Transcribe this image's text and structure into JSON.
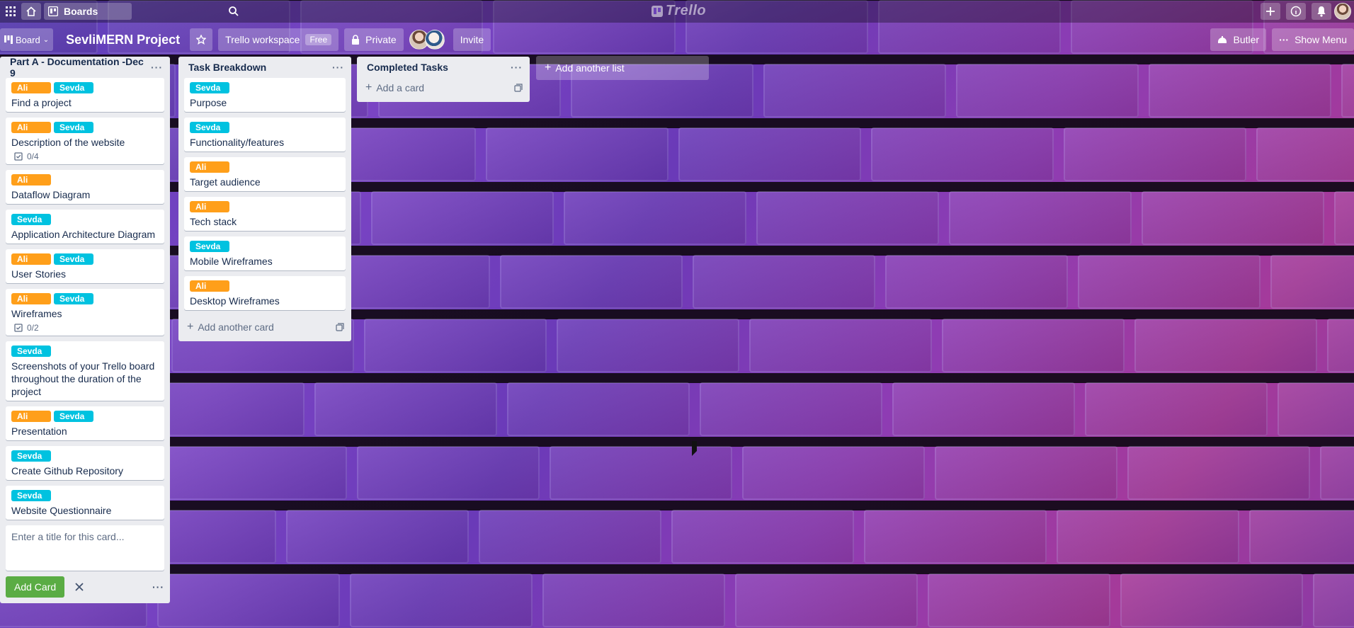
{
  "app": {
    "logo": "Trello",
    "boards_label": "Boards"
  },
  "board": {
    "view_label": "Board",
    "title": "SevliMERN Project",
    "workspace_label": "Trello workspace",
    "workspace_badge": "Free",
    "visibility_label": "Private",
    "invite_label": "Invite",
    "butler_label": "Butler",
    "menu_label": "Show Menu"
  },
  "lists": [
    {
      "title": "Part A - Documentation -Dec 9",
      "cards": [
        {
          "labels": [
            "Ali",
            "Sevda"
          ],
          "title": "Find a project"
        },
        {
          "labels": [
            "Ali",
            "Sevda"
          ],
          "title": "Description of the website",
          "checklist": "0/4"
        },
        {
          "labels": [
            "Ali"
          ],
          "title": "Dataflow Diagram"
        },
        {
          "labels": [
            "Sevda"
          ],
          "title": "Application Architecture Diagram"
        },
        {
          "labels": [
            "Ali",
            "Sevda"
          ],
          "title": "User Stories"
        },
        {
          "labels": [
            "Ali",
            "Sevda"
          ],
          "title": "Wireframes",
          "checklist": "0/2"
        },
        {
          "labels": [
            "Sevda"
          ],
          "title": "Screenshots of your Trello board throughout the duration of the project"
        },
        {
          "labels": [
            "Ali",
            "Sevda"
          ],
          "title": "Presentation"
        },
        {
          "labels": [
            "Sevda"
          ],
          "title": "Create Github Repository"
        },
        {
          "labels": [
            "Sevda"
          ],
          "title": "Website Questionnaire"
        }
      ],
      "composer_placeholder": "Enter a title for this card...",
      "composer_add_label": "Add Card"
    },
    {
      "title": "Task Breakdown",
      "cards": [
        {
          "labels": [
            "Sevda"
          ],
          "title": "Purpose"
        },
        {
          "labels": [
            "Sevda"
          ],
          "title": "Functionality/features"
        },
        {
          "labels": [
            "Ali"
          ],
          "title": "Target audience"
        },
        {
          "labels": [
            "Ali"
          ],
          "title": "Tech stack"
        },
        {
          "labels": [
            "Sevda"
          ],
          "title": "Mobile Wireframes"
        },
        {
          "labels": [
            "Ali"
          ],
          "title": "Desktop Wireframes"
        }
      ],
      "add_card_label": "Add another card"
    },
    {
      "title": "Completed Tasks",
      "cards": [],
      "add_card_label": "Add a card"
    }
  ],
  "add_list_label": "Add another list",
  "label_colors": {
    "Ali": "#ff9f1a",
    "Sevda": "#00c2e0"
  }
}
